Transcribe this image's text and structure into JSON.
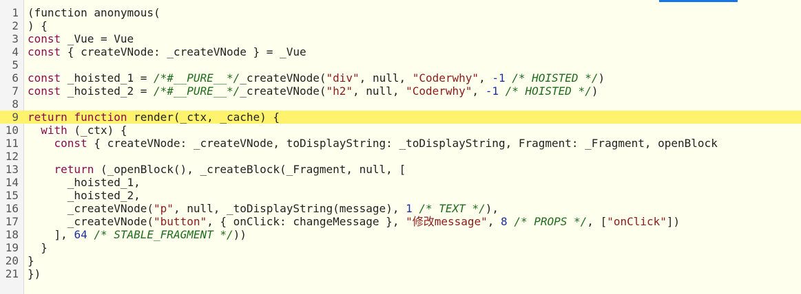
{
  "editor": {
    "highlighted_line": 9,
    "lines": [
      {
        "n": "1",
        "tokens": [
          [
            "pl",
            "(function anonymous("
          ]
        ]
      },
      {
        "n": "2",
        "tokens": [
          [
            "pl",
            ") {"
          ]
        ]
      },
      {
        "n": "3",
        "tokens": [
          [
            "kw",
            "const"
          ],
          [
            "pl",
            " _Vue = Vue"
          ]
        ]
      },
      {
        "n": "4",
        "tokens": [
          [
            "kw",
            "const"
          ],
          [
            "pl",
            " { createVNode: _createVNode } = _Vue"
          ]
        ]
      },
      {
        "n": "5",
        "tokens": []
      },
      {
        "n": "6",
        "tokens": [
          [
            "kw",
            "const"
          ],
          [
            "pl",
            " _hoisted_1 = "
          ],
          [
            "cm",
            "/*#__PURE__*/"
          ],
          [
            "pl",
            "_createVNode("
          ],
          [
            "str",
            "\"div\""
          ],
          [
            "pl",
            ", null, "
          ],
          [
            "str",
            "\"Coderwhy\""
          ],
          [
            "pl",
            ", "
          ],
          [
            "num",
            "-1"
          ],
          [
            "pl",
            " "
          ],
          [
            "cm",
            "/* HOISTED */"
          ],
          [
            "pl",
            ")"
          ]
        ]
      },
      {
        "n": "7",
        "tokens": [
          [
            "kw",
            "const"
          ],
          [
            "pl",
            " _hoisted_2 = "
          ],
          [
            "cm",
            "/*#__PURE__*/"
          ],
          [
            "pl",
            "_createVNode("
          ],
          [
            "str",
            "\"h2\""
          ],
          [
            "pl",
            ", null, "
          ],
          [
            "str",
            "\"Coderwhy\""
          ],
          [
            "pl",
            ", "
          ],
          [
            "num",
            "-1"
          ],
          [
            "pl",
            " "
          ],
          [
            "cm",
            "/* HOISTED */"
          ],
          [
            "pl",
            ")"
          ]
        ]
      },
      {
        "n": "8",
        "tokens": []
      },
      {
        "n": "9",
        "tokens": [
          [
            "kw",
            "return"
          ],
          [
            "pl",
            " "
          ],
          [
            "kw",
            "function"
          ],
          [
            "pl",
            " render(_ctx, _cache) {"
          ]
        ]
      },
      {
        "n": "10",
        "tokens": [
          [
            "pl",
            "  "
          ],
          [
            "kw",
            "with"
          ],
          [
            "pl",
            " (_ctx) {"
          ]
        ]
      },
      {
        "n": "11",
        "tokens": [
          [
            "pl",
            "    "
          ],
          [
            "kw",
            "const"
          ],
          [
            "pl",
            " { createVNode: _createVNode, toDisplayString: _toDisplayString, Fragment: _Fragment, openBlock"
          ]
        ]
      },
      {
        "n": "12",
        "tokens": []
      },
      {
        "n": "13",
        "tokens": [
          [
            "pl",
            "    "
          ],
          [
            "kw",
            "return"
          ],
          [
            "pl",
            " (_openBlock(), _createBlock(_Fragment, null, ["
          ]
        ]
      },
      {
        "n": "14",
        "tokens": [
          [
            "pl",
            "      _hoisted_1,"
          ]
        ]
      },
      {
        "n": "15",
        "tokens": [
          [
            "pl",
            "      _hoisted_2,"
          ]
        ]
      },
      {
        "n": "16",
        "tokens": [
          [
            "pl",
            "      _createVNode("
          ],
          [
            "str",
            "\"p\""
          ],
          [
            "pl",
            ", null, _toDisplayString(message), "
          ],
          [
            "num",
            "1"
          ],
          [
            "pl",
            " "
          ],
          [
            "cm",
            "/* TEXT */"
          ],
          [
            "pl",
            "),"
          ]
        ]
      },
      {
        "n": "17",
        "tokens": [
          [
            "pl",
            "      _createVNode("
          ],
          [
            "str",
            "\"button\""
          ],
          [
            "pl",
            ", { onClick: changeMessage }, "
          ],
          [
            "str",
            "\"修改message\""
          ],
          [
            "pl",
            ", "
          ],
          [
            "num",
            "8"
          ],
          [
            "pl",
            " "
          ],
          [
            "cm",
            "/* PROPS */"
          ],
          [
            "pl",
            ", ["
          ],
          [
            "str",
            "\"onClick\""
          ],
          [
            "pl",
            "])"
          ]
        ]
      },
      {
        "n": "18",
        "tokens": [
          [
            "pl",
            "    ], "
          ],
          [
            "num",
            "64"
          ],
          [
            "pl",
            " "
          ],
          [
            "cm",
            "/* STABLE_FRAGMENT */"
          ],
          [
            "pl",
            "))"
          ]
        ]
      },
      {
        "n": "19",
        "tokens": [
          [
            "pl",
            "  }"
          ]
        ]
      },
      {
        "n": "20",
        "tokens": [
          [
            "pl",
            "}"
          ]
        ]
      },
      {
        "n": "21",
        "tokens": [
          [
            "pl",
            "})"
          ]
        ]
      }
    ]
  }
}
